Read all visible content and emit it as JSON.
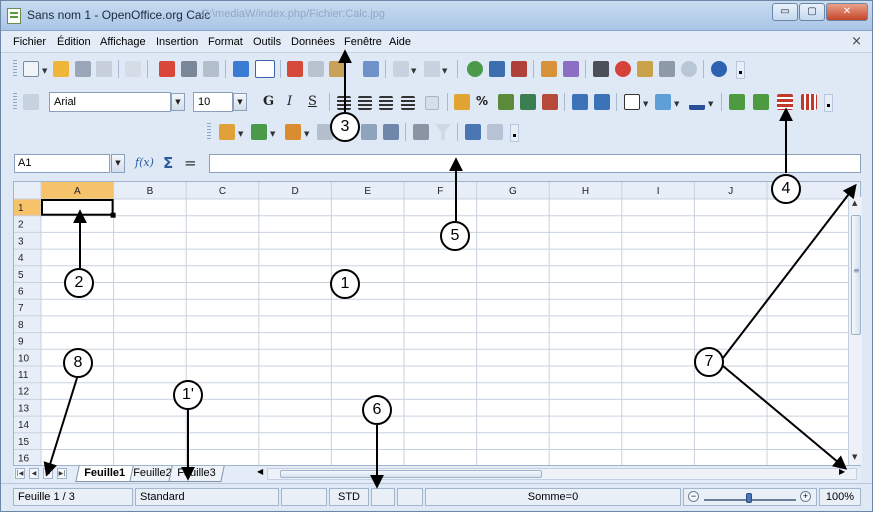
{
  "window": {
    "title": "Sans nom 1 - OpenOffice.org Calc",
    "bg_url_text": "C:\\mediaW/index.php/Fichier:Calc.jpg",
    "minimize_symbol": "▭",
    "maximize_symbol": "▢",
    "close_symbol": "✕"
  },
  "menu": {
    "items": [
      "Fichier",
      "Édition",
      "Affichage",
      "Insertion",
      "Format",
      "Outils",
      "Données",
      "Fenêtre",
      "Aide"
    ],
    "close_symbol": "×"
  },
  "toolbar_format": {
    "font_name": "Arial",
    "font_size": "10",
    "bold": "G",
    "italic": "I",
    "underline": "S",
    "percent": "%"
  },
  "formula_bar": {
    "name_box": "A1",
    "sigma": "Σ",
    "equals": "=",
    "function_symbol": "f(x)",
    "value": ""
  },
  "grid": {
    "columns": [
      "A",
      "B",
      "C",
      "D",
      "E",
      "F",
      "G",
      "H",
      "I",
      "J"
    ],
    "rows": [
      "1",
      "2",
      "3",
      "4",
      "5",
      "6",
      "7",
      "8",
      "9",
      "10",
      "11",
      "12",
      "13",
      "14",
      "15",
      "16"
    ],
    "selected_cell": "A1"
  },
  "sheets": {
    "tabs": [
      "Feuille1",
      "Feuille2",
      "Feuille3"
    ],
    "active": "Feuille1"
  },
  "status": {
    "sheet": "Feuille 1 / 3",
    "style": "Standard",
    "mode": "STD",
    "sum": "Somme=0",
    "zoom": "100%"
  },
  "callouts": [
    "1",
    "1'",
    "2",
    "3",
    "4",
    "5",
    "6",
    "7",
    "8"
  ],
  "colors": {
    "accent": "#4a77b4",
    "header_bg": "#e8eef7",
    "selected_header": "#f6c26a"
  }
}
